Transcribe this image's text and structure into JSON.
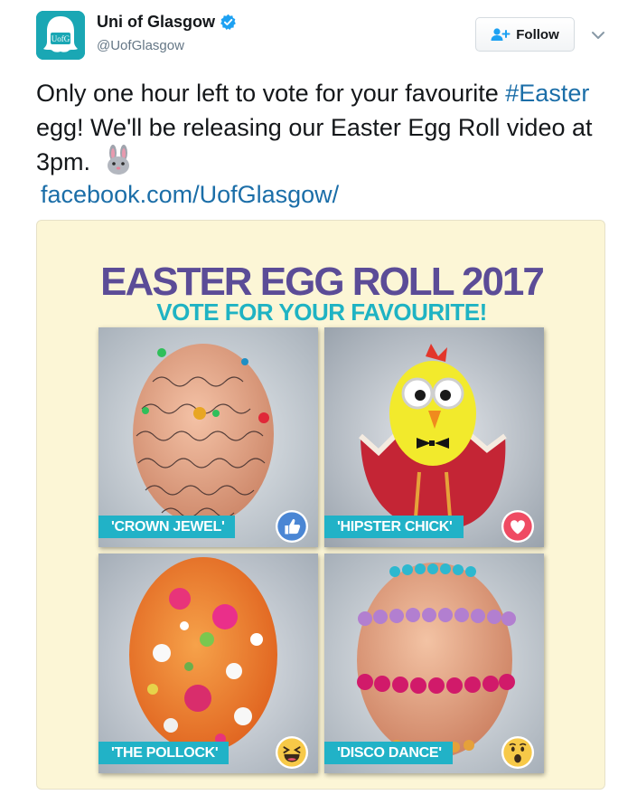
{
  "account": {
    "name": "Uni of Glasgow",
    "handle": "@UofGlasgow",
    "avatar_text": "UofG",
    "avatar_color": "#1aa7b4",
    "verified_icon": "verified-badge-icon"
  },
  "follow": {
    "label": "Follow",
    "icon": "add-user-icon"
  },
  "more_icon": "chevron-down-icon",
  "tweet": {
    "text_part1": "Only one hour left to vote for your favourite ",
    "hashtag": "#Easter",
    "text_part2": " egg! We'll be releasing our Easter Egg Roll video at 3pm.",
    "emoji": "rabbit-face-icon",
    "link": "facebook.com/UofGlasgow/"
  },
  "media": {
    "title": "EASTER EGG ROLL 2017",
    "subtitle": "VOTE FOR YOUR FAVOURITE!",
    "title_color": "#5b4c97",
    "subtitle_color": "#1fb3c3",
    "background": "#fcf6d6",
    "eggs": [
      {
        "label": "'CROWN JEWEL'",
        "reaction": "like-icon"
      },
      {
        "label": "'HIPSTER CHICK'",
        "reaction": "love-icon"
      },
      {
        "label": "'THE POLLOCK'",
        "reaction": "haha-icon"
      },
      {
        "label": "'DISCO DANCE'",
        "reaction": "wow-icon"
      }
    ]
  }
}
